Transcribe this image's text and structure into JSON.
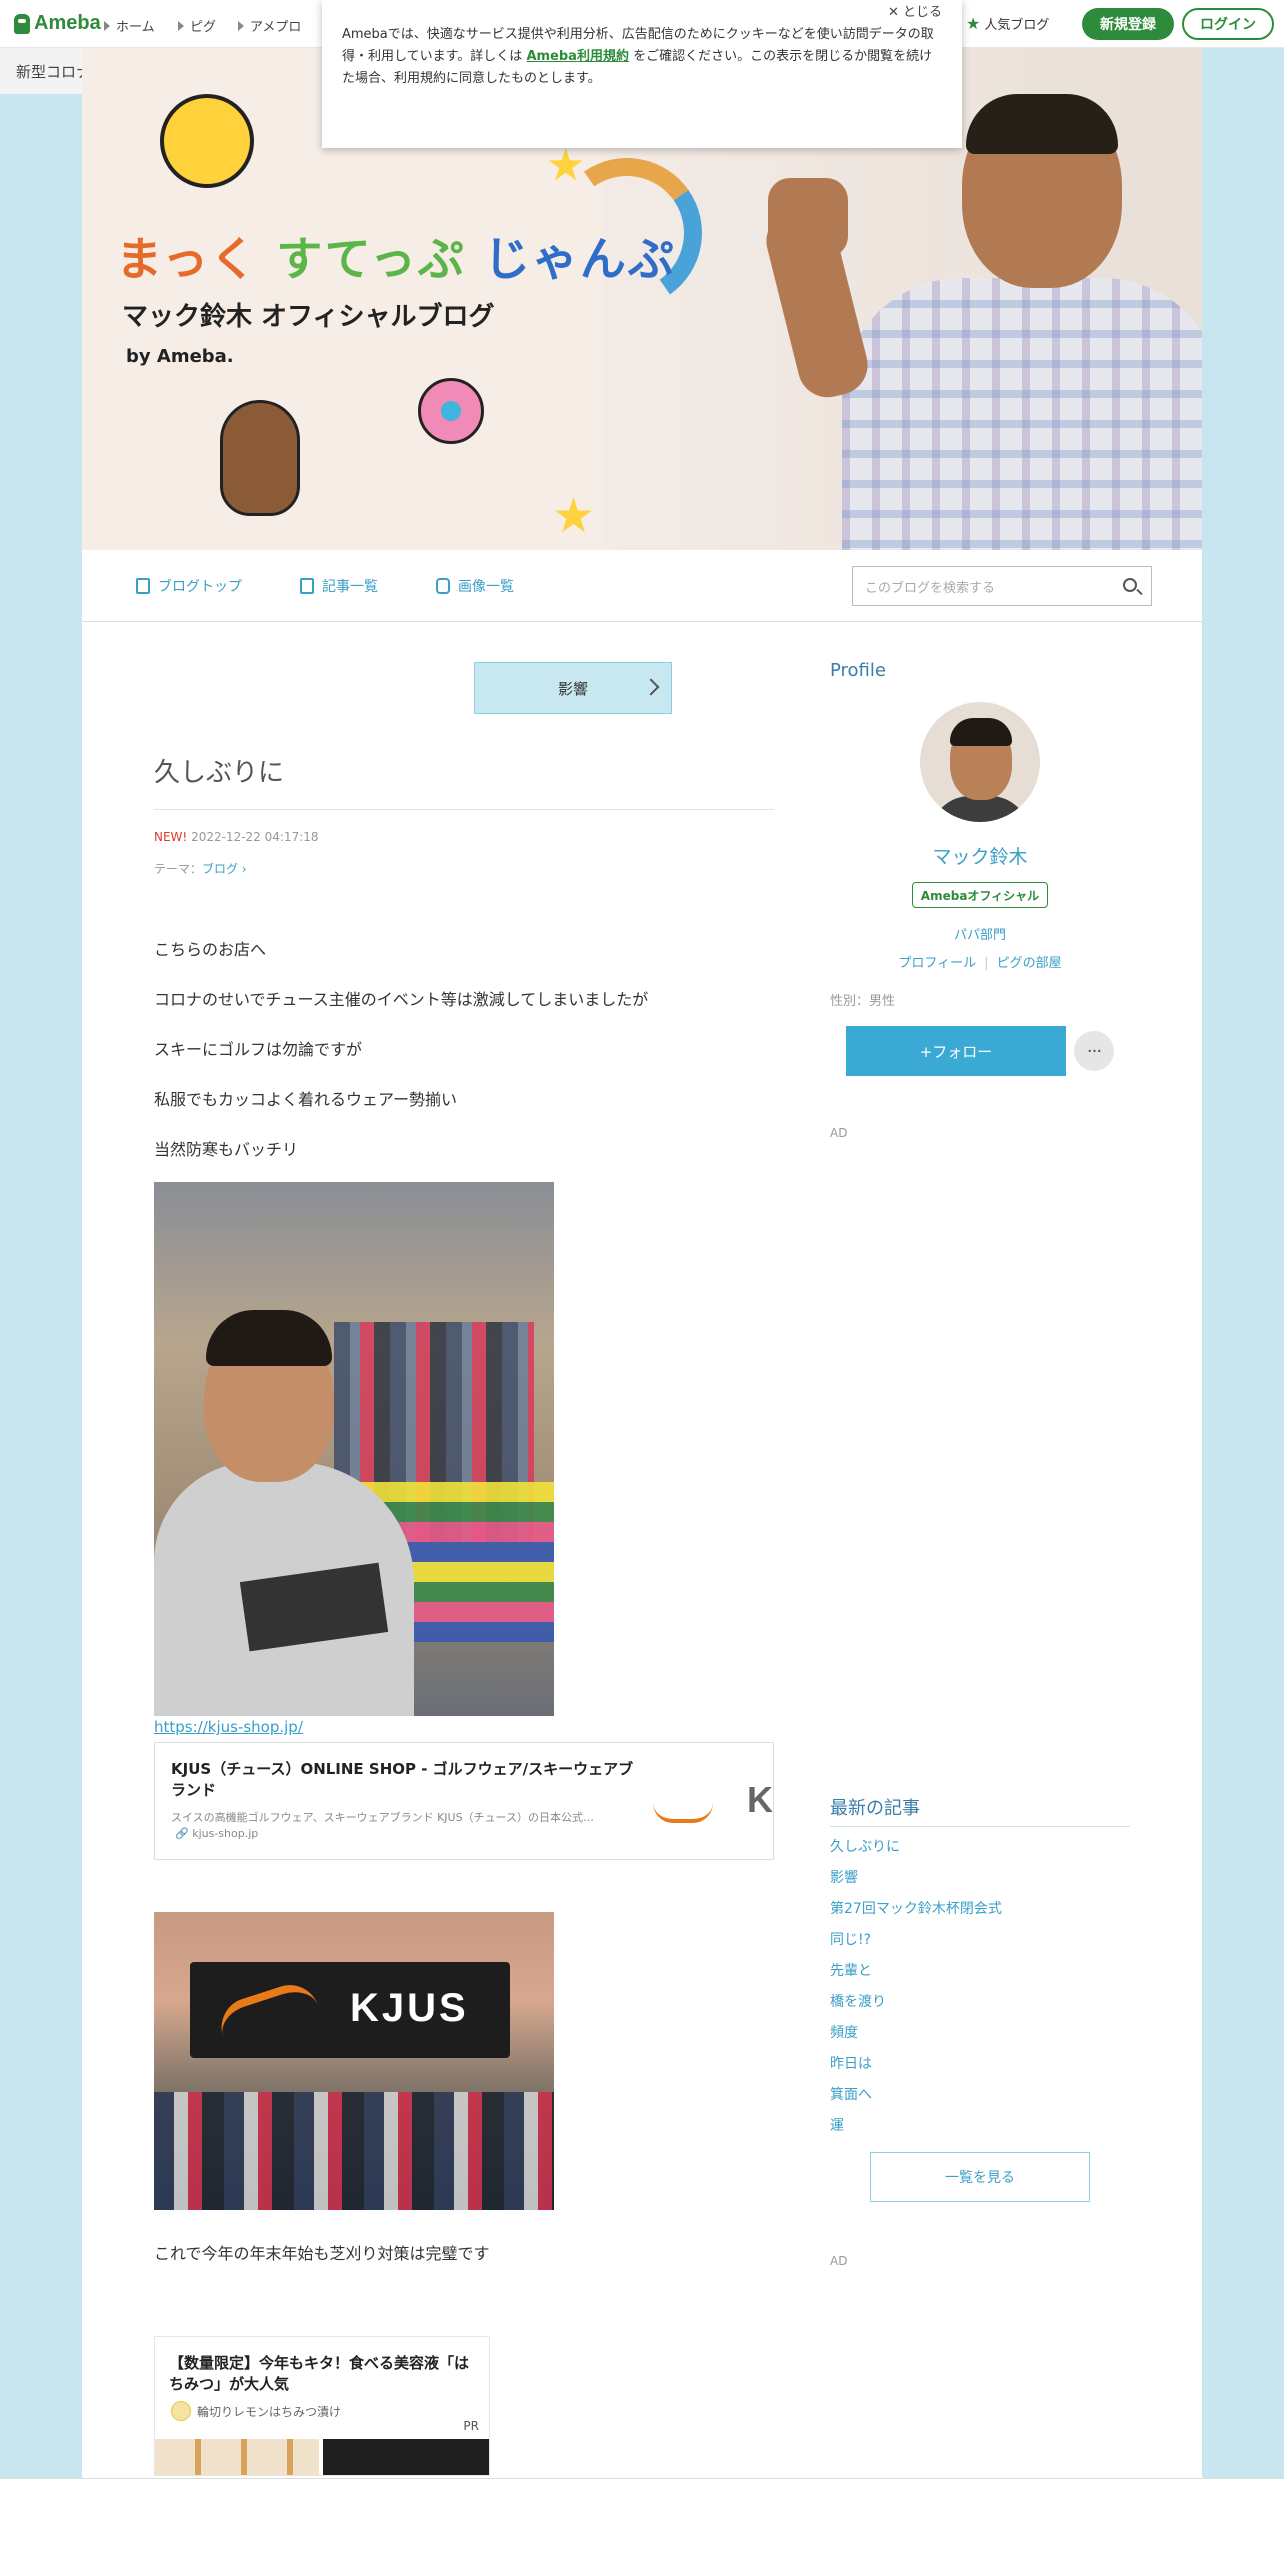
{
  "topbar": {
    "logo": "Ameba",
    "nav": [
      "ホーム",
      "ピグ",
      "アメプロ"
    ],
    "popular": "人気ブログ",
    "signup": "新規登録",
    "login": "ログイン"
  },
  "covid_bar": {
    "text": "新型コロナウイルスに関する情報について",
    "chevron": ">"
  },
  "cookie": {
    "text_before": "Amebaでは、快適なサービス提供や利用分析、広告配信のためにクッキーなどを使い訪問データの取得・利用しています。詳しくは ",
    "link": "Ameba利用規約",
    "text_after": " をご確認ください。この表示を閉じるか閲覧を続けた場合、利用規約に同意したものとします。",
    "close": "✕ とじる"
  },
  "banner": {
    "title_a": "まっく",
    "title_b": "すてっぷ",
    "title_c": "じゃんぷ",
    "subtitle": "マック鈴木 オフィシャルブログ",
    "by": "by Ameba."
  },
  "blognav": {
    "items": [
      "ブログトップ",
      "記事一覧",
      "画像一覧"
    ],
    "search_placeholder": "このブログを検索する"
  },
  "article": {
    "prev_label": "影響",
    "title": "久しぶりに",
    "new_badge": "NEW!",
    "datetime": "2022-12-22 04:17:18",
    "theme_label": "テーマ：",
    "theme": "ブログ",
    "paragraphs": [
      "こちらのお店へ",
      "コロナのせいでチュース主催のイベント等は激減してしまいましたが",
      "スキーにゴルフは勿論ですが",
      "私服でもカッコよく着れるウェアー勢揃い",
      "当然防寒もバッチリ"
    ],
    "link_url": "https://kjus-shop.jp/",
    "link_card": {
      "title": "KJUS（チュース）ONLINE SHOP - ゴルフウェア/スキーウェアブランド",
      "desc": "スイスの高機能ゴルフウェア、スキーウェアブランド KJUS（チュース）の日本公式…",
      "domain": "kjus-shop.jp",
      "thumb_letter": "K"
    },
    "sign_text": "KJUS",
    "closing": "これで今年の年末年始も芝刈り対策は完璧です",
    "ad": {
      "title": "【数量限定】今年もキタ！食べる美容液「はちみつ」が大人気",
      "advertiser": "輪切りレモンはちみつ漬け",
      "pr": "PR"
    }
  },
  "sidebar": {
    "profile_heading": "Profile",
    "name": "マック鈴木",
    "official": "Amebaオフィシャル",
    "category": "パパ部門",
    "links": [
      "プロフィール",
      "ピグの部屋"
    ],
    "gender": "性別：男性",
    "follow": "+フォロー",
    "more": "···",
    "ad_label": "AD",
    "recent_heading": "最新の記事",
    "recent": [
      "久しぶりに",
      "影響",
      "第27回マック鈴木杯閉会式",
      "同じ!?",
      "先輩と",
      "橋を渡り",
      "頻度",
      "昨日は",
      "箕面へ",
      "運"
    ],
    "view_all": "一覧を見る"
  },
  "colors": {
    "brand_green": "#2d8c3c",
    "accent_blue": "#3a9fc8",
    "background": "#c8e6ef"
  }
}
